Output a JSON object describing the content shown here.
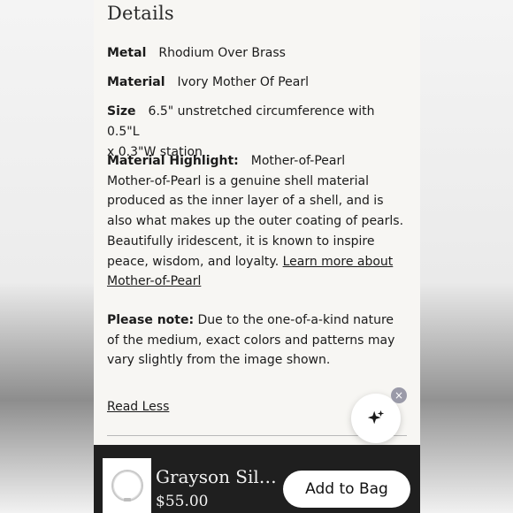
{
  "details": {
    "title": "Details",
    "metal_label": "Metal",
    "metal_value": "Rhodium Over Brass",
    "material_label": "Material",
    "material_value": "Ivory Mother Of Pearl",
    "size_label": "Size",
    "size_value_line1": "6.5\" unstretched circumference with 0.5\"L",
    "size_value_line2": "x 0.3\"W station",
    "highlight_label": "Material Highlight:",
    "highlight_value": "Mother-of-Pearl",
    "highlight_text": "Mother-of-Pearl is a genuine shell material produced as the inner layer of a shell, and is also what makes up the outer coating of pearls. Beautifully iridescent, it is known to inspire peace, wisdom, and loyalty.",
    "learn_more_link": "Learn more about Mother-of-Pearl",
    "note_label": "Please note:",
    "note_text": "Due to the one-of-a-kind nature of the medium, exact colors and patterns may vary slightly from the image shown.",
    "read_less": "Read Less"
  },
  "ai_assistant": {
    "icon": "sparkle-icon",
    "close_icon": "close-icon",
    "close_glyph": "×"
  },
  "sticky_bar": {
    "product_name": "Grayson Silv...",
    "price": "$55.00",
    "add_to_bag": "Add to Bag"
  },
  "colors": {
    "page_bg": "#f7f6f3",
    "bar_bg": "#1f1f1f",
    "text": "#1b1b1b"
  }
}
